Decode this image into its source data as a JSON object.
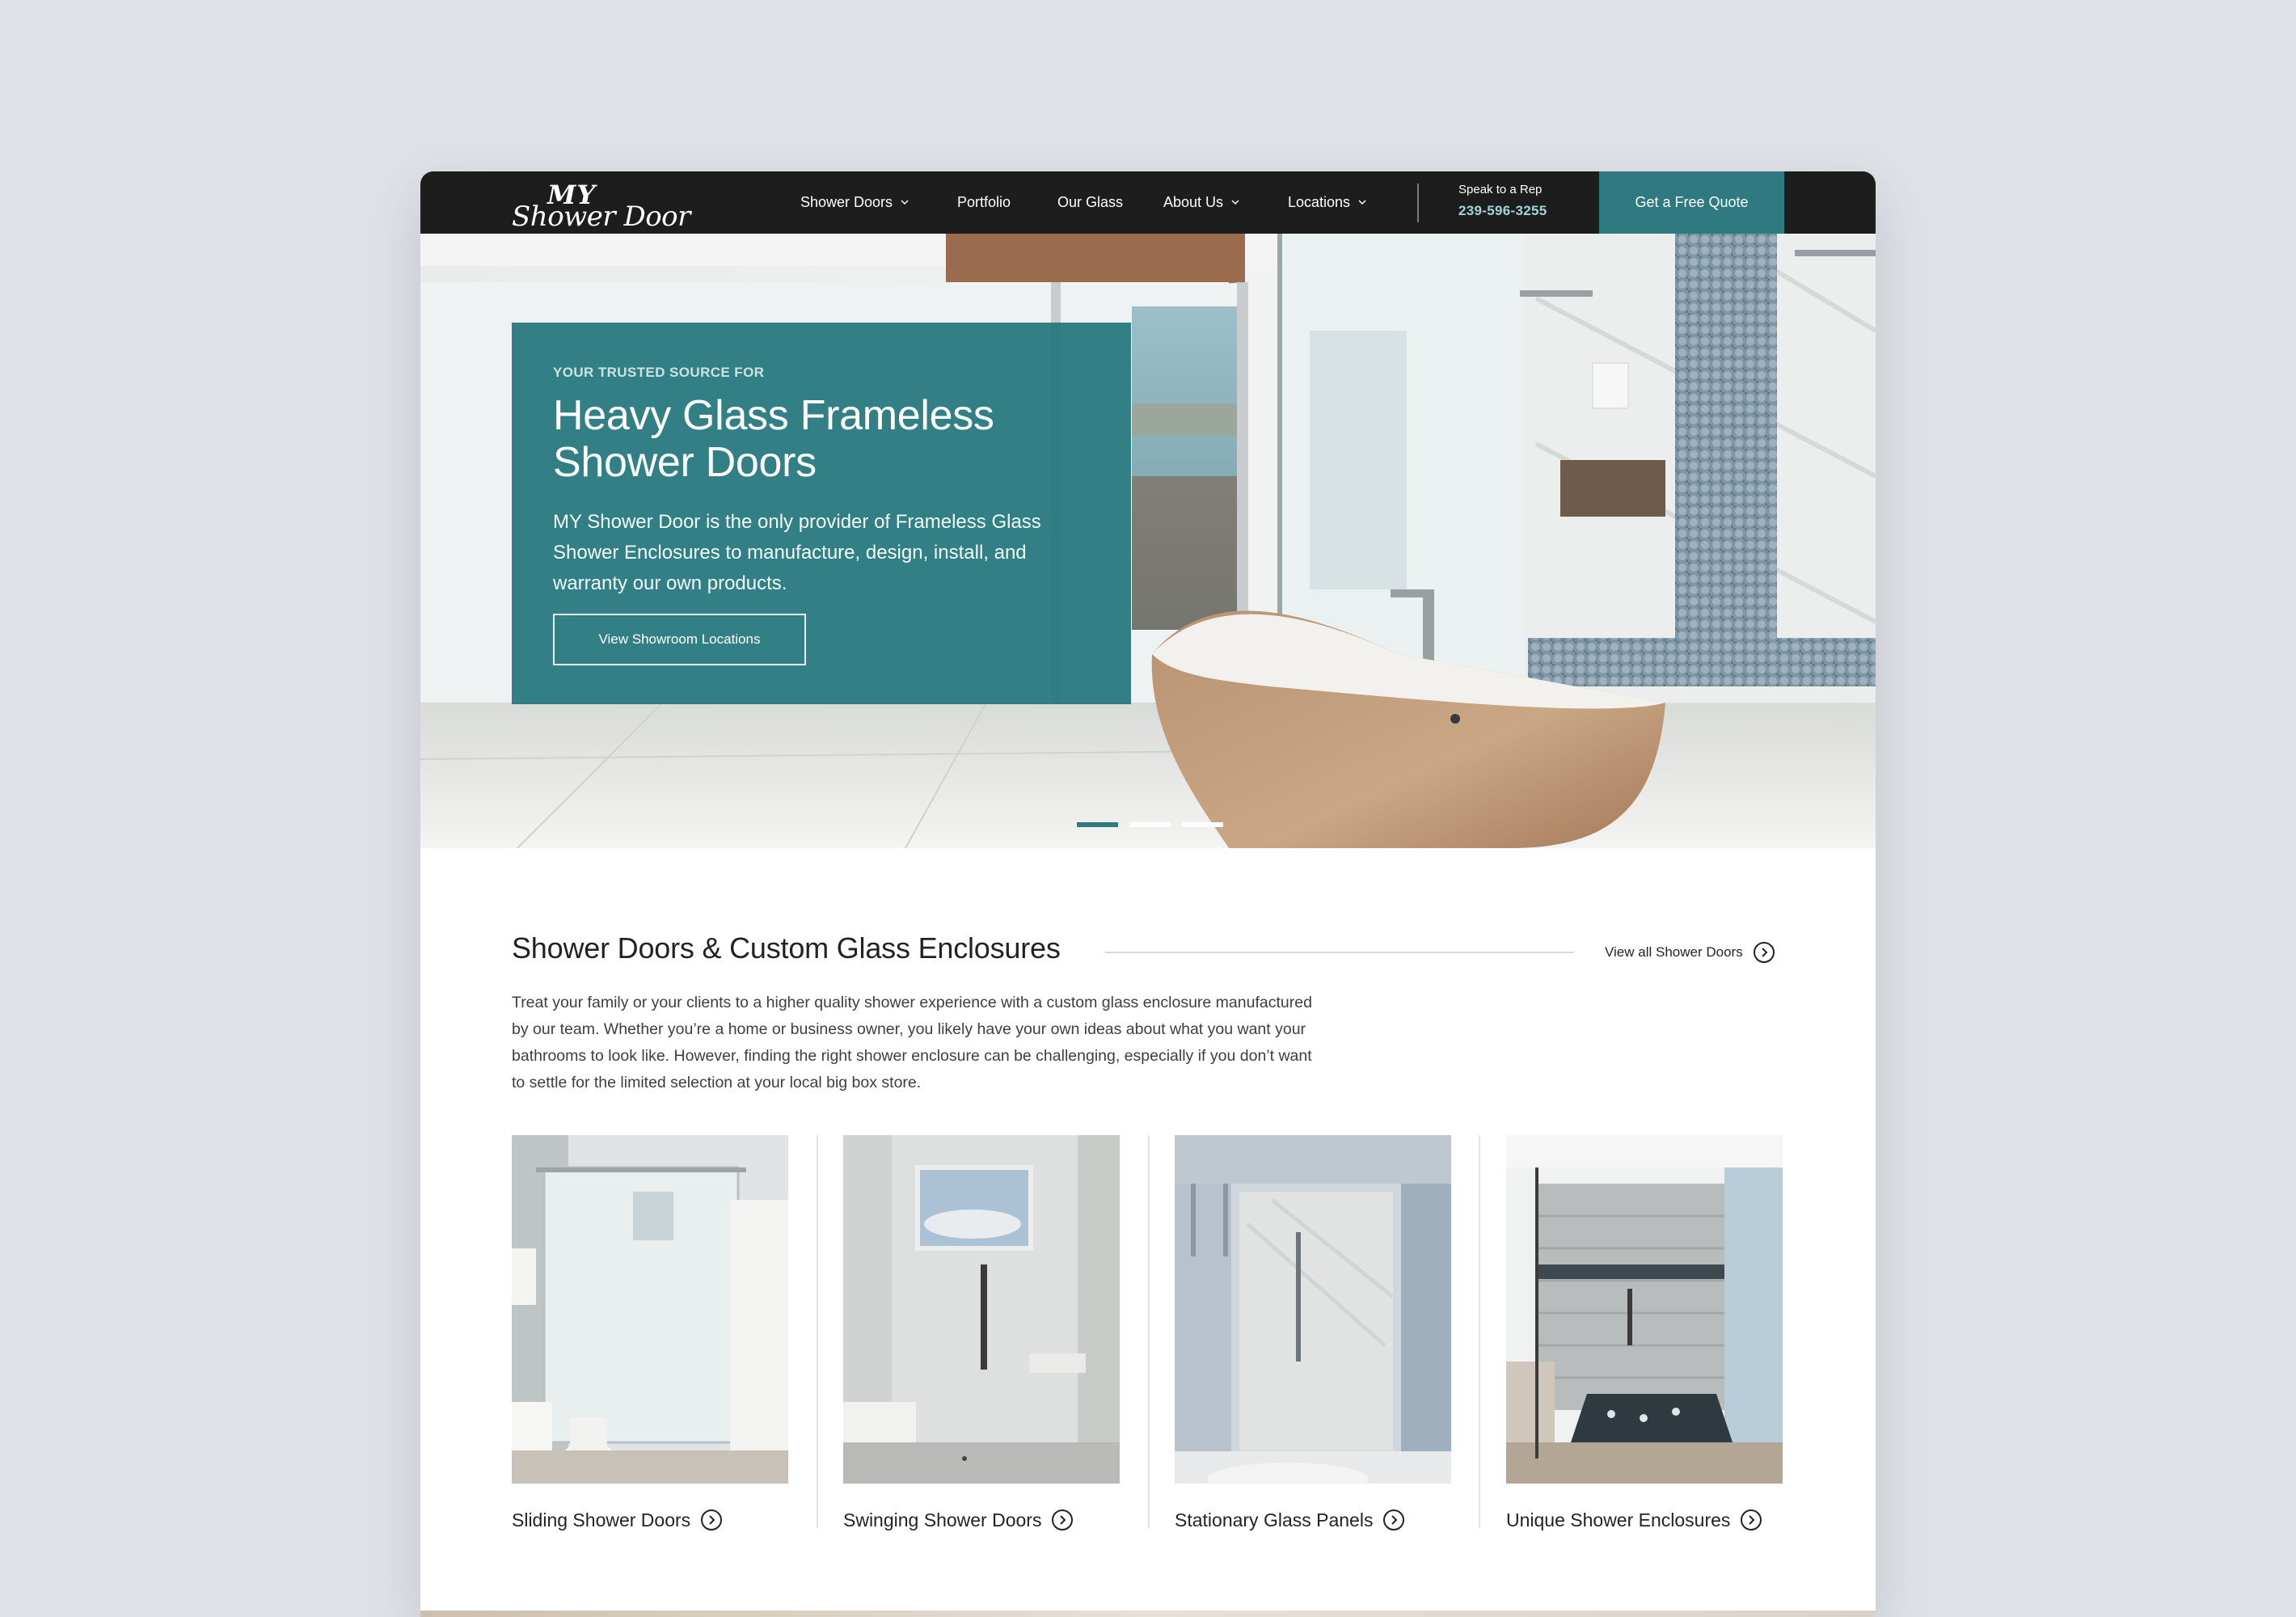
{
  "brand": {
    "logo_top": "MY",
    "logo_bottom": "Shower Door"
  },
  "nav": {
    "items": [
      {
        "label": "Shower Doors",
        "has_dropdown": true
      },
      {
        "label": "Portfolio",
        "has_dropdown": false
      },
      {
        "label": "Our Glass",
        "has_dropdown": false
      },
      {
        "label": "About Us",
        "has_dropdown": true
      },
      {
        "label": "Locations",
        "has_dropdown": true
      }
    ],
    "rep_label": "Speak to a Rep",
    "rep_phone": "239-596-3255",
    "cta": "Get a Free Quote"
  },
  "hero": {
    "eyebrow": "YOUR TRUSTED SOURCE FOR",
    "title": "Heavy Glass Frameless Shower Doors",
    "text": "MY Shower Door is the only provider of Frameless Glass Shower Enclosures to manufacture, design, install, and warranty our own products.",
    "button": "View Showroom Locations",
    "slides_total": 3,
    "slide_active": 1
  },
  "section": {
    "title": "Shower Doors & Custom Glass Enclosures",
    "view_all": "View all Shower Doors",
    "description": "Treat your family or your clients to a higher quality shower experience with a custom glass enclosure manufactured by our team. Whether you’re a home or business owner, you likely have your own ideas about what you want your bathrooms to look like. However, finding the right shower enclosure can be challenging, especially if you don’t want to settle for the limited selection at your local big box store."
  },
  "cards": [
    {
      "label": "Sliding Shower Doors"
    },
    {
      "label": "Swinging Shower Doors"
    },
    {
      "label": "Stationary Glass Panels"
    },
    {
      "label": "Unique Shower Enclosures"
    }
  ],
  "colors": {
    "accent": "#2e7a80",
    "nav_bg": "#1d1d1d",
    "phone": "#9fd6da",
    "page_bg": "#dfe2e7"
  },
  "icons": {
    "dropdown": "chevron-down-icon",
    "link_arrow": "circle-arrow-right-icon"
  }
}
